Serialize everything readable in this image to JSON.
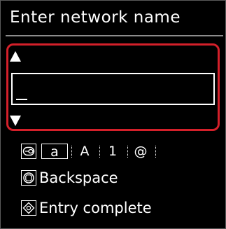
{
  "screen": {
    "title": "Enter network name"
  },
  "entry": {
    "value": "",
    "scroll_up_icon": "triangle-up",
    "scroll_down_icon": "triangle-down"
  },
  "input_mode": {
    "key_icon": "input-mode-key-icon",
    "modes": [
      "a",
      "A",
      "1",
      "@"
    ],
    "selected": "a"
  },
  "actions": [
    {
      "label": "Backspace",
      "icon": "stop-key-icon"
    },
    {
      "label": "Entry complete",
      "icon": "ok-key-icon"
    }
  ],
  "colors": {
    "background": "#000000",
    "text": "#ffffff",
    "highlight_border": "#d4202a",
    "divider": "#8c8c8c"
  }
}
